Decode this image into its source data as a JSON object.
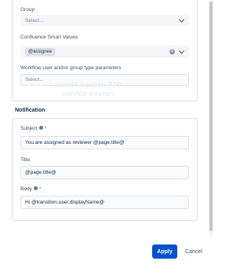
{
  "top_section": {
    "group_label": "Group",
    "group_placeholder": "Select...",
    "confluence_label": "Confluence Smart Values",
    "confluence_chip": "@assignee",
    "workflow_label": "Workflow user and/or group type parameters",
    "workflow_placeholder": "Select..."
  },
  "watermark": {
    "line1": "nivedit.naveen.720",
    "line2": "sahilde.kaptan"
  },
  "notification": {
    "title": "Notification",
    "subject_label": "Subject",
    "subject_value": "You are assigned as reviewer @page.title@",
    "title_label": "Title",
    "title_value": "@page.title@",
    "body_label": "Body",
    "body_value": "Hi @transition.user.displayName@"
  },
  "footer": {
    "apply_label": "Apply",
    "cancel_label": "Cancel"
  },
  "colors": {
    "primary": "#0052cc",
    "required": "#de350b"
  }
}
